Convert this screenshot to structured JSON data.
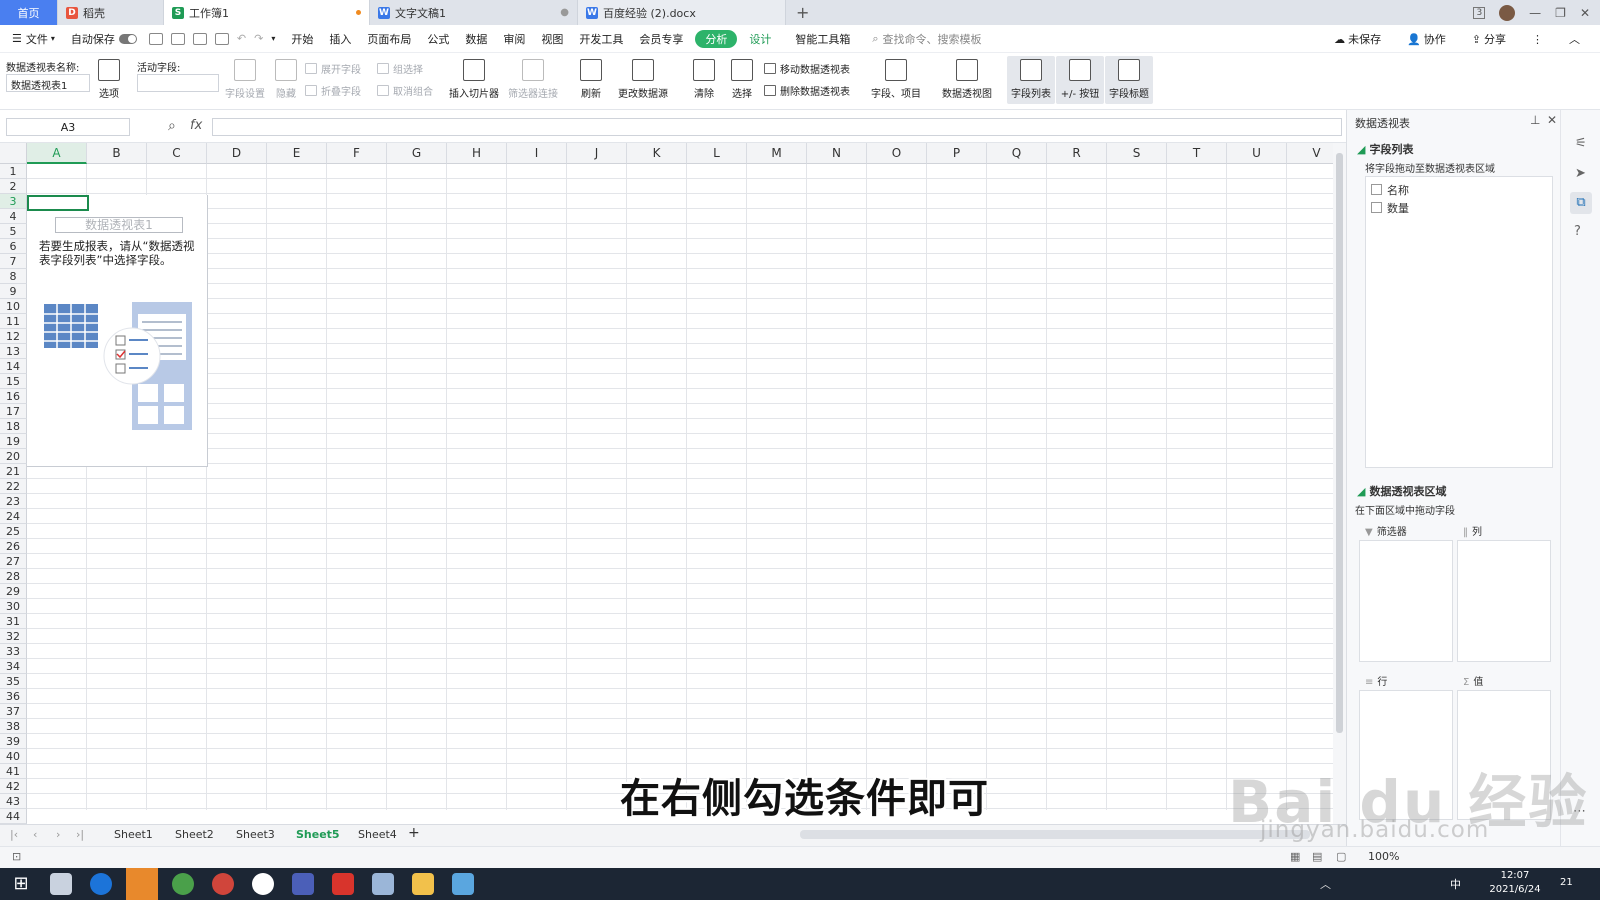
{
  "titlebar": {
    "tabs": [
      {
        "label": "首页"
      },
      {
        "label": "稻壳"
      },
      {
        "label": "工作簿1"
      },
      {
        "label": "文字文稿1"
      },
      {
        "label": "百度经验 (2).docx"
      }
    ],
    "add": "+",
    "window_count": "3"
  },
  "menubar": {
    "file": "文件",
    "autosave": "自动保存",
    "items": [
      "开始",
      "插入",
      "页面布局",
      "公式",
      "数据",
      "审阅",
      "视图",
      "开发工具",
      "会员专享"
    ],
    "analyze": "分析",
    "design": "设计",
    "smart_tools": "智能工具箱",
    "search": "查找命令、搜索模板",
    "unsaved": "未保存",
    "collab": "协作",
    "share": "分享"
  },
  "ribbon": {
    "pivot_name_label": "数据透视表名称:",
    "pivot_name_value": "数据透视表1",
    "options": "选项",
    "active_field_label": "活动字段:",
    "field_settings": "字段设置",
    "hide": "隐藏",
    "expand_field": "展开字段",
    "collapse_field": "折叠字段",
    "group_select": "组选择",
    "ungroup": "取消组合",
    "insert_slicer": "插入切片器",
    "filter_conn": "筛选器连接",
    "refresh": "刷新",
    "change_source": "更改数据源",
    "clear": "清除",
    "select": "选择",
    "move_pivot": "移动数据透视表",
    "delete_pivot": "删除数据透视表",
    "fields_items": "字段、项目",
    "pivot_chart": "数据透视图",
    "field_list": "字段列表",
    "plusminus": "+/- 按钮",
    "field_headers": "字段标题"
  },
  "formulabar": {
    "namebox": "A3",
    "fx": "fx"
  },
  "grid": {
    "columns": [
      "A",
      "B",
      "C",
      "D",
      "E",
      "F",
      "G",
      "H",
      "I",
      "J",
      "K",
      "L",
      "M",
      "N",
      "O",
      "P",
      "Q",
      "R",
      "S",
      "T",
      "U",
      "V"
    ],
    "rows": [
      "1",
      "2",
      "3",
      "4",
      "5",
      "6",
      "7",
      "8",
      "9",
      "10",
      "11",
      "12",
      "13",
      "14",
      "15",
      "16",
      "17",
      "18",
      "19",
      "20",
      "21",
      "22",
      "23",
      "24",
      "25",
      "26",
      "27",
      "28",
      "29",
      "30",
      "31",
      "32",
      "33",
      "34",
      "35",
      "36",
      "37",
      "38",
      "39",
      "40",
      "41",
      "42",
      "43",
      "44"
    ]
  },
  "pivot": {
    "placeholder_title": "数据透视表1",
    "hint": "若要生成报表，请从“数据透视表字段列表”中选择字段。"
  },
  "sheets": {
    "tabs": [
      "Sheet1",
      "Sheet2",
      "Sheet3",
      "Sheet5",
      "Sheet4"
    ],
    "active": "Sheet5",
    "add": "+"
  },
  "panel": {
    "title": "数据透视表",
    "field_list": "字段列表",
    "drag_hint": "将字段拖动至数据透视表区域",
    "fields": [
      {
        "label": "名称"
      },
      {
        "label": "数量"
      }
    ],
    "area_title": "数据透视表区域",
    "area_hint": "在下面区域中拖动字段",
    "filter": "筛选器",
    "columns": "列",
    "rows": "行",
    "values": "值"
  },
  "statusbar": {
    "zoom": "100%"
  },
  "taskbar": {
    "time": "12:07",
    "date": "2021/6/24",
    "ime": "中",
    "notif": "21"
  },
  "subtitle": "在右侧勾选条件即可",
  "watermark": {
    "logo": "Bai du 经验",
    "url": "jingyan.baidu.com"
  },
  "colors": {
    "accent_green": "#2db36a",
    "home_tab": "#4a7ff0",
    "selection": "#1b8b4d"
  }
}
